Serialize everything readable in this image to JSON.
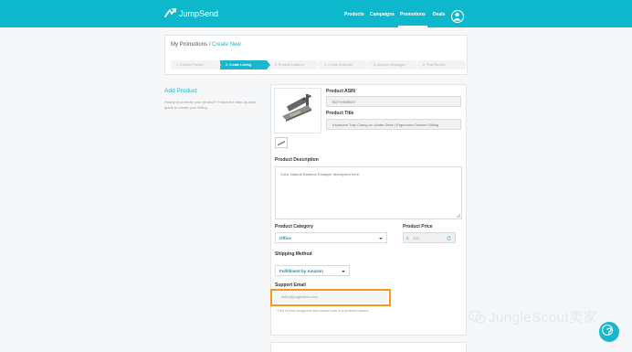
{
  "nav": {
    "logo": "JumpSend",
    "links": [
      "Products",
      "Campaigns",
      "Promotions",
      "Deals"
    ],
    "active": "Promotions"
  },
  "breadcrumb": {
    "parent": "My Promotions",
    "separator": "/",
    "current": "Create New"
  },
  "steps": [
    "1. Choose Product",
    "2. Create Listing",
    "3. Product Audience",
    "4. Create Channels",
    "5. Approve Messages",
    "6. Final Review"
  ],
  "active_step": "2. Create Listing",
  "sidebar": {
    "title": "Add Product",
    "description": "Ready to promote your product? Follow the step-by-step guide to create your listing."
  },
  "form": {
    "asin_label": "Product ASIN",
    "asin_value": "B07YH93B2G",
    "title_label": "Product Title",
    "title_value": "Keyboard Tray Clamp-on Under Desk | Ergonomic Drawer Sliding",
    "description_label": "Product Description",
    "description_value": "Color-Natural Bamboo Example description here.",
    "category_label": "Product Category",
    "category_value": "Office",
    "price_label": "Product Price",
    "price_prefix": "$",
    "price_value": "100",
    "shipping_label": "Shipping Method",
    "shipping_value": "Fulfillment by Amazon",
    "email_label": "Support Email",
    "email_placeholder": "hello@jungleaero.com",
    "help_text": "* This is how shoppers will contact you if a problem arises."
  },
  "watermark": "JungleScout卖家",
  "help_button": "?",
  "colors": {
    "primary": "#0eb8cc",
    "highlight": "#f29a1e"
  }
}
